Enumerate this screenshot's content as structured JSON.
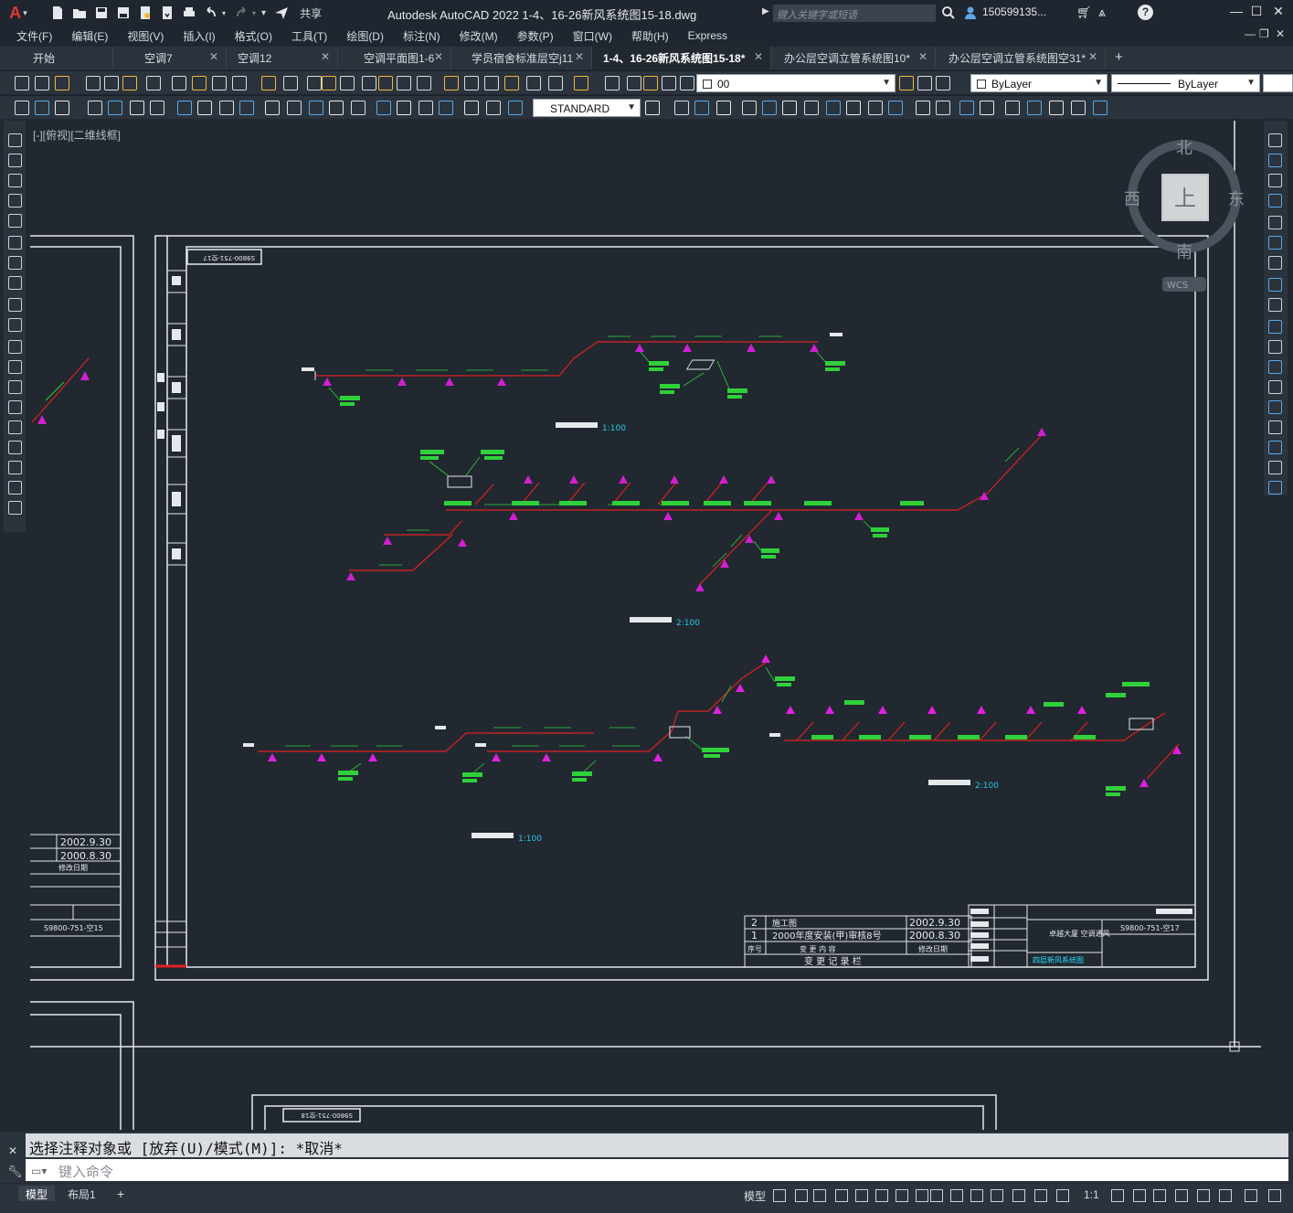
{
  "app": {
    "logo": "A",
    "title": "Autodesk AutoCAD 2022    1-4、16-26新风系统图15-18.dwg",
    "share": "共享",
    "search_placeholder": "键入关键字或短语",
    "user": "1505991​35...",
    "min": "—",
    "max": "☐",
    "close": "✕"
  },
  "menu": [
    "文件(F)",
    "编辑(E)",
    "视图(V)",
    "插入(I)",
    "格式(O)",
    "工具(T)",
    "绘图(D)",
    "标注(N)",
    "修改(M)",
    "参数(P)",
    "窗口(W)",
    "帮助(H)",
    "Express"
  ],
  "tabs": [
    {
      "label": "开始",
      "active": false
    },
    {
      "label": "空调7",
      "active": false
    },
    {
      "label": "空调12",
      "active": false
    },
    {
      "label": "空调平面图1-6",
      "active": false
    },
    {
      "label": "学员宿舍标准层空j11",
      "active": false
    },
    {
      "label": "1-4、16-26新风系统图15-18*",
      "active": true
    },
    {
      "label": "办公层空调立管系统图10*",
      "active": false
    },
    {
      "label": "办公层空调立管系统图空31*",
      "active": false
    }
  ],
  "toolbar": {
    "layer_value": "00",
    "color_value": "ByLayer",
    "linetype_value": "ByLayer",
    "textstyle_value": "STANDARD"
  },
  "viewport": {
    "label": "[-][俯视][二维线框]",
    "viewcube": {
      "north": "北",
      "south": "南",
      "east": "东",
      "west": "西",
      "top": "上",
      "wcs": "WCS"
    }
  },
  "drawing": {
    "frame_id_top": "S9800-751-空17",
    "caption_1": "四层新风系统图",
    "scale_1": "1:100",
    "caption_2": "四层新风系统图",
    "scale_2": "2:100",
    "caption_3": "四层新风系统图",
    "scale_3": "1:100",
    "caption_4": "四层新风系统图",
    "scale_4": "2:100",
    "rev_rows": [
      {
        "no": "2",
        "content": "施工图",
        "date": "2002.9.30"
      },
      {
        "no": "1",
        "content": "2000年度安装(甲)审核8号",
        "date": "2000.8.30"
      }
    ],
    "rev_header": {
      "no": "序号",
      "content": "变 更 内 容",
      "date": "修改日期"
    },
    "rev_title": "变 更 记 录 栏",
    "project": "卓越大厦\n空调通风",
    "drawing_no": "S9800-751-空17",
    "sheet_title": "四层新风系统图",
    "left_dates": [
      "2002.9.30",
      "2000.8.30"
    ],
    "left_no": "S9800-751-空15",
    "left_date_label": "修改日期",
    "bottom_frame_id": "S9800-751-空18"
  },
  "command": {
    "history": "选择注释对象或 [放弃(U)/模式(M)]: *取消*",
    "placeholder": "键入命令"
  },
  "status": {
    "tabs": [
      "模型",
      "布局1"
    ],
    "add": "+",
    "model_label": "模型",
    "scale": "1:1"
  }
}
